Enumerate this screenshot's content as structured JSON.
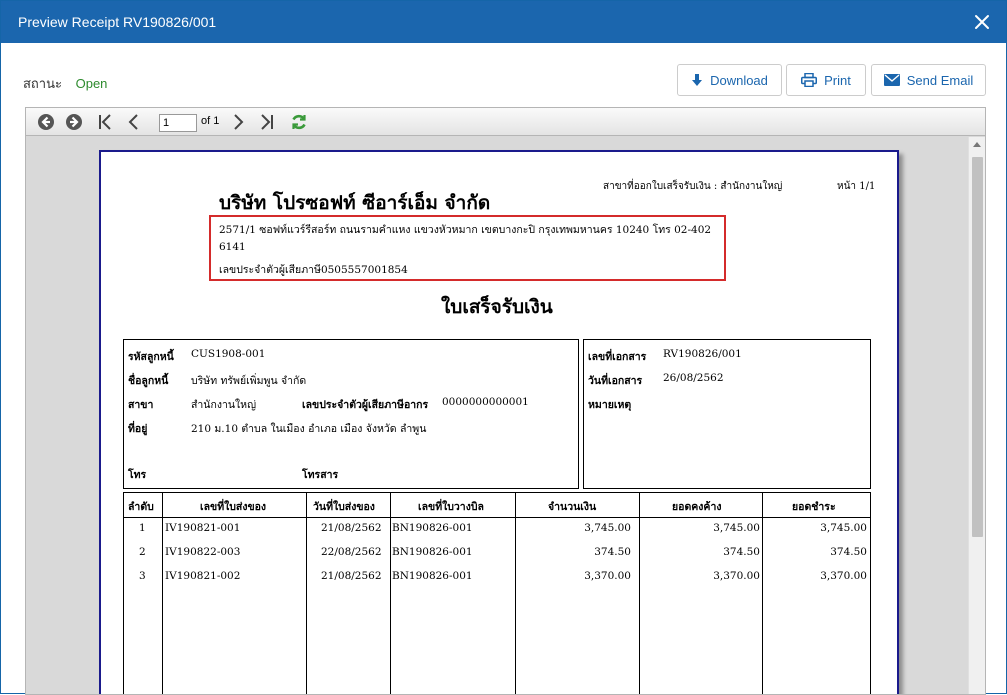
{
  "window": {
    "title": "Preview Receipt RV190826/001"
  },
  "status": {
    "label": "สถานะ",
    "value": "Open"
  },
  "actions": {
    "download": "Download",
    "print": "Print",
    "send_email": "Send Email"
  },
  "viewer": {
    "current_page": "1",
    "page_of": "of 1"
  },
  "receipt": {
    "branch_issue": "สาขาที่ออกใบเสร็จรับเงิน : สำนักงานใหญ่",
    "page_label": "หน้า 1/1",
    "company_name": "บริษัท โปรซอฟท์ ซีอาร์เอ็ม จำกัด",
    "address_line1": "2571/1 ซอฟท์แวร์รีสอร์ท ถนนรามคำแหง แขวงหัวหมาก เขตบางกะปิ กรุงเทพมหานคร 10240 โทร 02-402",
    "address_line2": "6141",
    "tax_line": "เลขประจำตัวผู้เสียภาษี0505557001854",
    "doc_title": "ใบเสร็จรับเงิน",
    "customer": {
      "code_label": "รหัสลูกหนี้",
      "code": "CUS1908-001",
      "name_label": "ชื่อลูกหนี้",
      "name": "บริษัท ทรัพย์เพิ่มพูน จำกัด",
      "branch_label": "สาขา",
      "branch": "สำนักงานใหญ่",
      "taxid_label": "เลขประจำตัวผู้เสียภาษีอากร",
      "taxid": "0000000000001",
      "address_label": "ที่อยู่",
      "address": "210 ม.10 ตำบล ในเมือง อำเภอ เมือง จังหวัด ลำพูน",
      "phone_label": "โทร",
      "fax_label": "โทรสาร"
    },
    "document": {
      "docno_label": "เลขที่เอกสาร",
      "docno": "RV190826/001",
      "date_label": "วันที่เอกสาร",
      "date": "26/08/2562",
      "note_label": "หมายเหตุ"
    },
    "table": {
      "headers": [
        "ลำดับ",
        "เลขที่ใบส่งของ",
        "วันที่ใบส่งของ",
        "เลขที่ใบวางบิล",
        "จำนวนเงิน",
        "ยอดคงค้าง",
        "ยอดชำระ"
      ],
      "rows": [
        [
          "1",
          "IV190821-001",
          "21/08/2562",
          "BN190826-001",
          "3,745.00",
          "3,745.00",
          "3,745.00"
        ],
        [
          "2",
          "IV190822-003",
          "22/08/2562",
          "BN190826-001",
          "374.50",
          "374.50",
          "374.50"
        ],
        [
          "3",
          "IV190821-002",
          "21/08/2562",
          "BN190826-001",
          "3,370.00",
          "3,370.00",
          "3,370.00"
        ]
      ]
    }
  }
}
